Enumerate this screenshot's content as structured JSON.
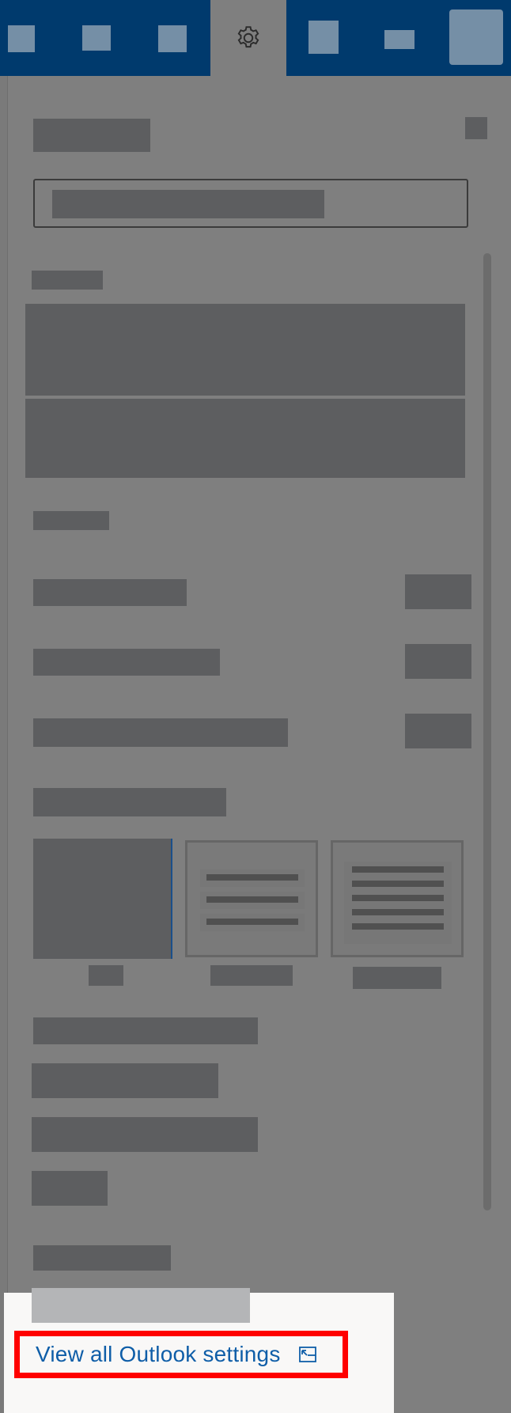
{
  "footer": {
    "view_all_settings_label": "View all Outlook settings"
  },
  "icons": {
    "settings": "gear-icon",
    "popout": "open-in-new-window-icon"
  },
  "colors": {
    "topbar": "#003a6d",
    "link": "#0f5ea8",
    "highlight": "#ff0000"
  }
}
